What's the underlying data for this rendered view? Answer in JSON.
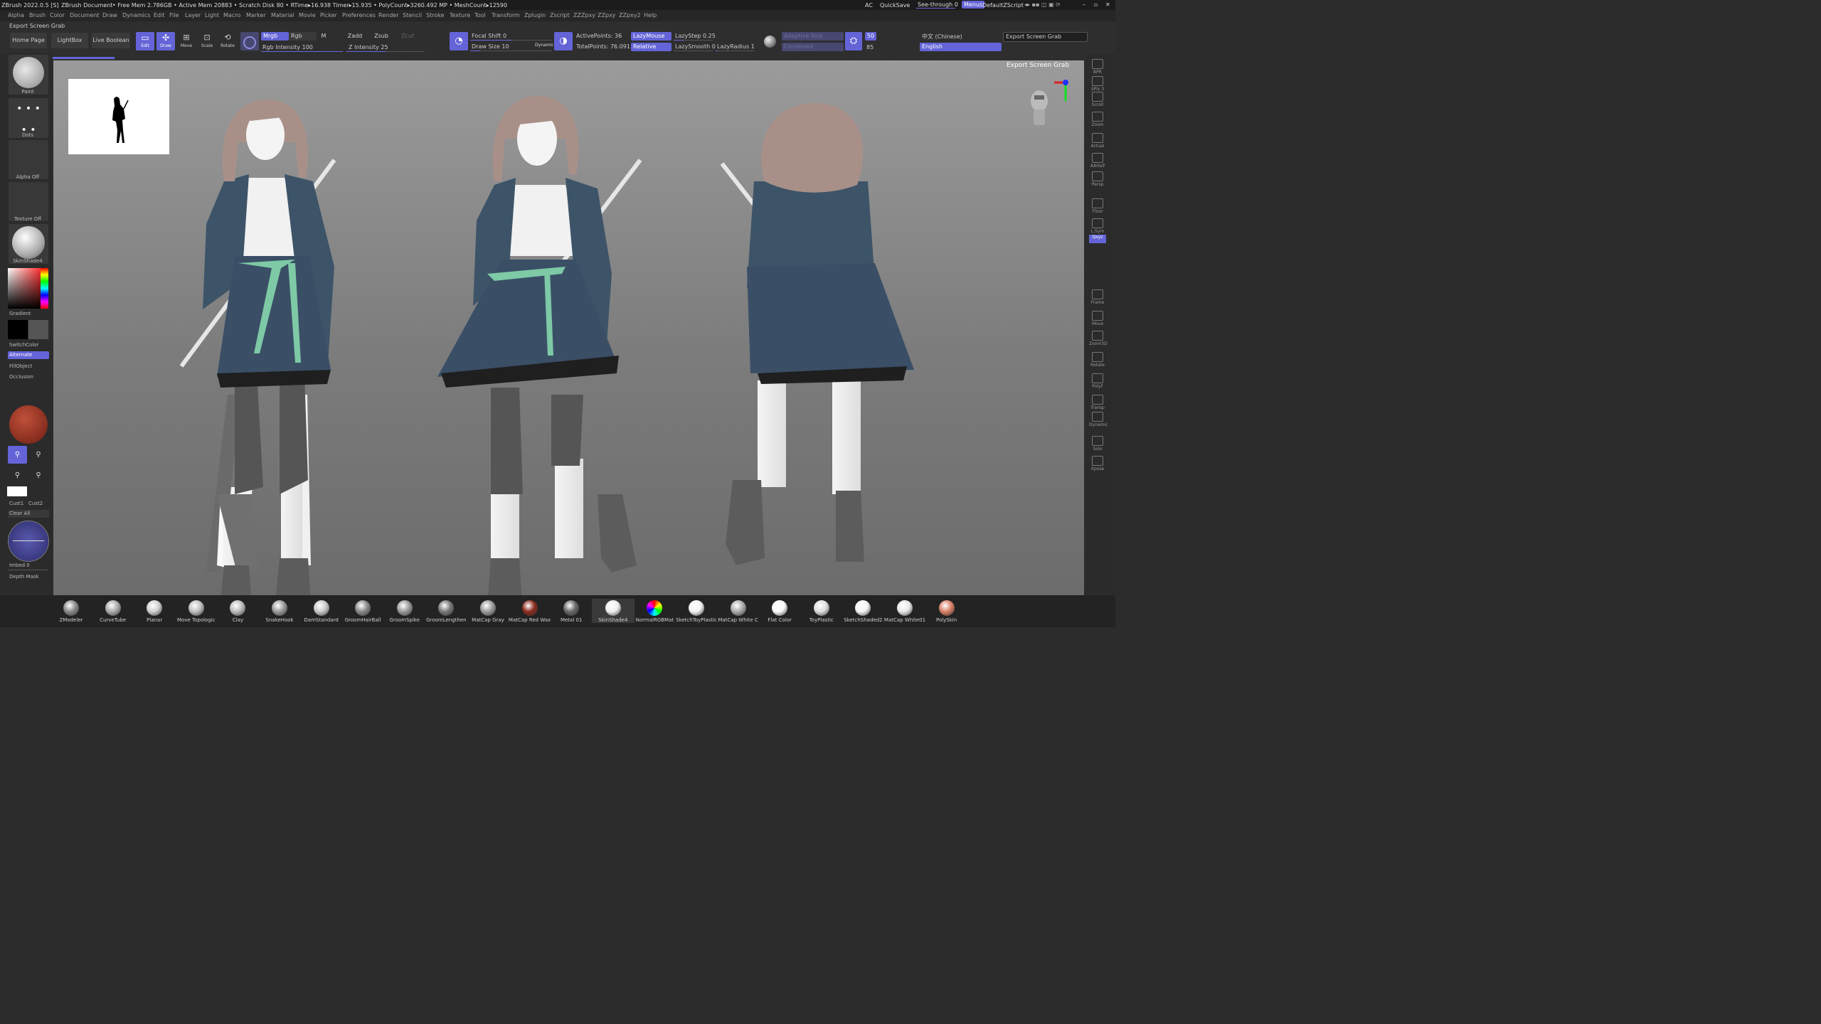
{
  "titlebar": {
    "app": "ZBrush 2022.0.5 [S]",
    "doc": "ZBrush Document",
    "stats": "• Free Mem 2.786GB • Active Mem 20883 • Scratch Disk 80 • RTime▸16.938 Timer▸15.935 • PolyCount▸3260.492 MP • MeshCount▸12590",
    "ac": "AC",
    "quicksave": "QuickSave",
    "see_through": "See-through  0",
    "menus": "Menus",
    "script": "DefaultZScript"
  },
  "menubar": [
    "Alpha",
    "Brush",
    "Color",
    "Document",
    "Draw",
    "Dynamics",
    "Edit",
    "File",
    "Layer",
    "Light",
    "Macro",
    "Marker",
    "Material",
    "Movie",
    "Picker",
    "Preferences",
    "Render",
    "Stencil",
    "Stroke",
    "Texture",
    "Tool",
    "Transform",
    "Zplugin",
    "Zscript",
    "ZZZpxy",
    "ZZpxy",
    "ZZpxy2",
    "Help"
  ],
  "export_label_top": "Export Screen Grab",
  "topshelf": {
    "home_page": "Home Page",
    "lightbox": "LightBox",
    "live_boolean": "Live Boolean",
    "edit": "Edit",
    "draw": "Draw",
    "move": "Move",
    "scale": "Scale",
    "rotate": "Rotate",
    "mrgb": "Mrgb",
    "rgb": "Rgb",
    "m": "M",
    "zadd": "Zadd",
    "zsub": "Zsub",
    "zcut": "Zcut",
    "rgb_intensity": "Rgb Intensity 100",
    "z_intensity": "Z Intensity 25",
    "focal_shift": "Focal Shift 0",
    "draw_size": "Draw Size 10",
    "dynamic": "Dynamic",
    "active_points": "ActivePoints: 36",
    "total_points": "TotalPoints: 76.091 Mil",
    "lazymouse": "LazyMouse",
    "relative": "Relative",
    "lazystep": "LazyStep 0.25",
    "lazysmooth": "LazySmooth 0",
    "lazyradius": "LazyRadius 1",
    "adaptive_size": "Adaptive Size",
    "combined": "Combined",
    "num50": "50",
    "num85": "85",
    "lang_cn": "中文 (Chinese)",
    "lang_en": "English",
    "export_btn": "Export Screen Grab"
  },
  "leftshelf": {
    "paint": "Paint",
    "dots": "Dots",
    "alpha_off": "Alpha Off",
    "texture_off": "Texture Off",
    "skinshade": "SkinShade4",
    "gradient": "Gradient",
    "switchcolor": "SwitchColor",
    "alternate": "Alternate",
    "fillobject": "FillObject",
    "occlusion": "Occlusion",
    "cust1": "Cust1",
    "cust2": "Cust2",
    "clear_all": "Clear All",
    "imbed": "Imbed 0",
    "depth_mask": "Depth Mask"
  },
  "viewport": {
    "export_label": "Export Screen Grab"
  },
  "rightshelf": [
    "BPR",
    "SPix 3",
    "Scroll",
    "Zoom",
    "Actual",
    "AAHalf",
    "Persp",
    "Floor",
    "L.Sym",
    "Qxyz",
    "Frame",
    "Move",
    "Zoom3D",
    "Rotate",
    "PolyF",
    "Transp",
    "Dynamic",
    "Solo",
    "Xpose"
  ],
  "materials": [
    "ZModeler",
    "CurveTube",
    "Planar",
    "Move Topologic",
    "Clay",
    "SnakeHook",
    "DamStandard",
    "GroomHairBall",
    "GroomSpike",
    "GroomLengthen",
    "MatCap Gray",
    "MatCap Red Wax",
    "Metal 01",
    "SkinShade4",
    "NormalRGBMat",
    "SketchToyPlastic",
    "MatCap White C",
    "Flat Color",
    "ToyPlastic",
    "SketchShaded2",
    "MatCap White01",
    "PolySkin"
  ],
  "colors": {
    "accent": "#6464d8",
    "jacket": "#3d5468",
    "skirt": "#3a4f66",
    "belt": "#7ec9a6",
    "hair": "#a89089"
  }
}
